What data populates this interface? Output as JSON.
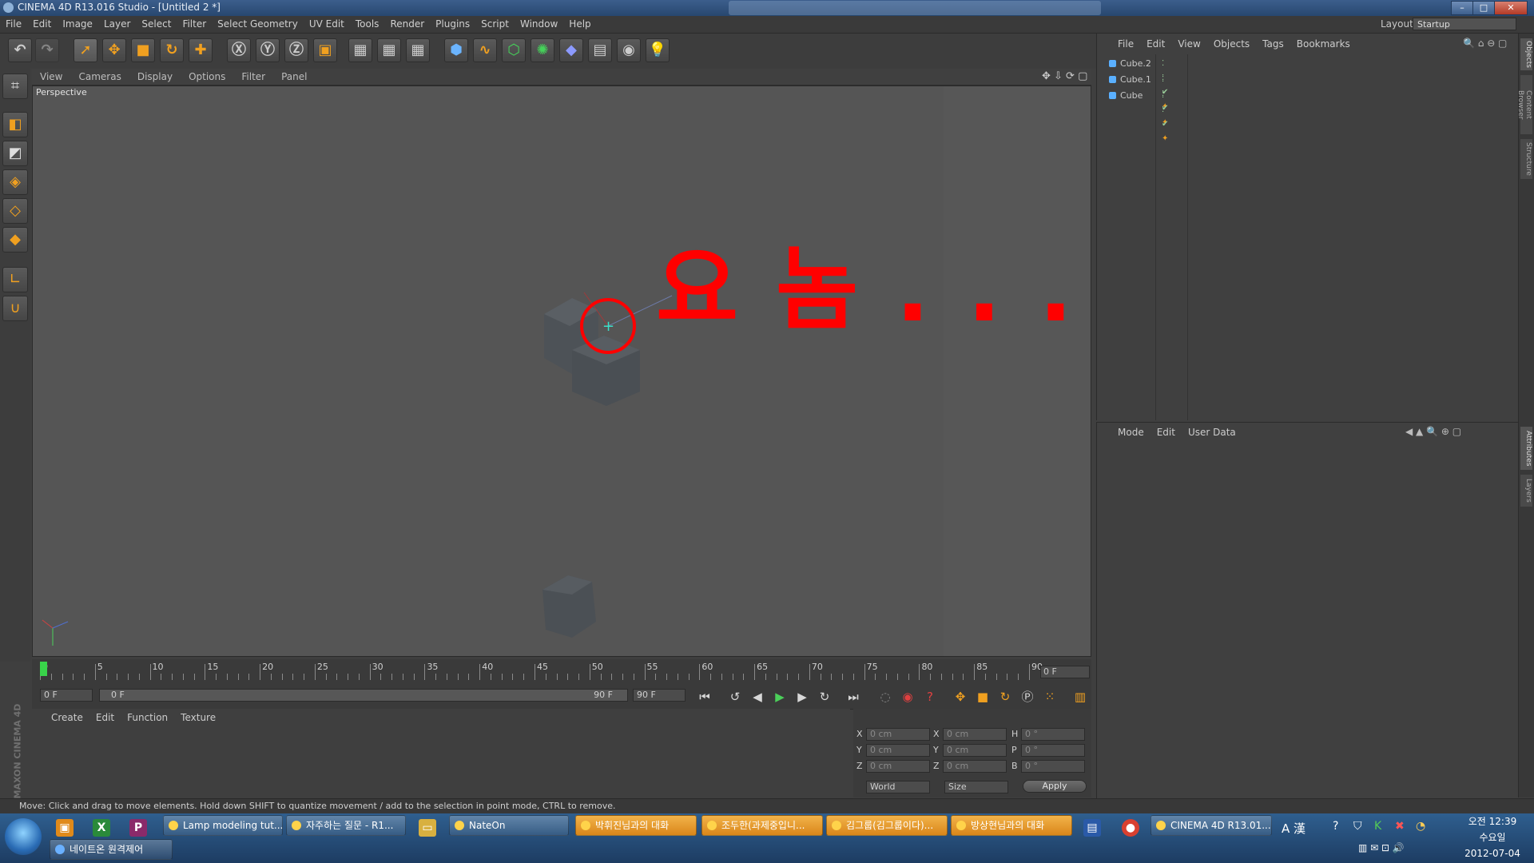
{
  "window": {
    "title": "CINEMA 4D R13.016 Studio - [Untitled 2 *]"
  },
  "menu": [
    "File",
    "Edit",
    "Image",
    "Layer",
    "Select",
    "Filter",
    "Select Geometry",
    "UV Edit",
    "Tools",
    "Render",
    "Plugins",
    "Script",
    "Window",
    "Help"
  ],
  "layout": {
    "label": "Layout:",
    "value": "Startup"
  },
  "viewport": {
    "menu": [
      "View",
      "Cameras",
      "Display",
      "Options",
      "Filter",
      "Panel"
    ],
    "label": "Perspective",
    "annotation": "요 놈 . . ."
  },
  "timeline": {
    "ticks": [
      "0",
      "5",
      "10",
      "15",
      "20",
      "25",
      "30",
      "35",
      "40",
      "45",
      "50",
      "55",
      "60",
      "65",
      "70",
      "75",
      "80",
      "85",
      "90"
    ],
    "current_frame": "0 F",
    "start_field": "0 F",
    "range_start": "0 F",
    "range_end": "90 F",
    "end_field": "90 F"
  },
  "material_manager": {
    "menu": [
      "Create",
      "Edit",
      "Function",
      "Texture"
    ]
  },
  "coordinates": {
    "rows": [
      {
        "a": "X",
        "av": "0 cm",
        "b": "X",
        "bv": "0 cm",
        "c": "H",
        "cv": "0 °"
      },
      {
        "a": "Y",
        "av": "0 cm",
        "b": "Y",
        "bv": "0 cm",
        "c": "P",
        "cv": "0 °"
      },
      {
        "a": "Z",
        "av": "0 cm",
        "b": "Z",
        "bv": "0 cm",
        "c": "B",
        "cv": "0 °"
      }
    ],
    "mode1": "World",
    "mode2": "Size",
    "apply": "Apply"
  },
  "status": "Move: Click and drag to move elements. Hold down SHIFT to quantize movement / add to the selection in point mode, CTRL to remove.",
  "object_manager": {
    "menu": [
      "File",
      "Edit",
      "View",
      "Objects",
      "Tags",
      "Bookmarks"
    ],
    "objects": [
      "Cube.2",
      "Cube.1",
      "Cube"
    ]
  },
  "attributes": {
    "menu": [
      "Mode",
      "Edit",
      "User Data"
    ]
  },
  "right_tabs": [
    "Objects",
    "Content Browser",
    "Structure",
    "Attributes",
    "Layers"
  ],
  "maxon": "MAXON CINEMA 4D",
  "taskbar": {
    "row1": [
      {
        "label": "Lamp modeling tut...",
        "style": "normal"
      },
      {
        "label": "자주하는 질문 - R1...",
        "style": "normal"
      },
      {
        "label": "NateOn",
        "style": "normal"
      },
      {
        "label": "박휘진님과의 대화",
        "style": "orange"
      },
      {
        "label": "조두한(과제중입니...",
        "style": "orange"
      },
      {
        "label": "김그룹(김그룹이다)...",
        "style": "orange"
      },
      {
        "label": "방상현님과의 대화",
        "style": "orange"
      },
      {
        "label": "CINEMA 4D R13.01...",
        "style": "normal"
      }
    ],
    "row2": [
      {
        "label": "네이트온 원격제어",
        "style": "normal"
      }
    ],
    "ime": "A 漢"
  },
  "clock": {
    "time": "오전 12:39",
    "day": "수요일",
    "date": "2012-07-04"
  },
  "colors": {
    "accent_orange": "#f0a020",
    "annotation_red": "#ff0000",
    "playhead_green": "#39d34a",
    "viewport_bg": "#555555"
  }
}
